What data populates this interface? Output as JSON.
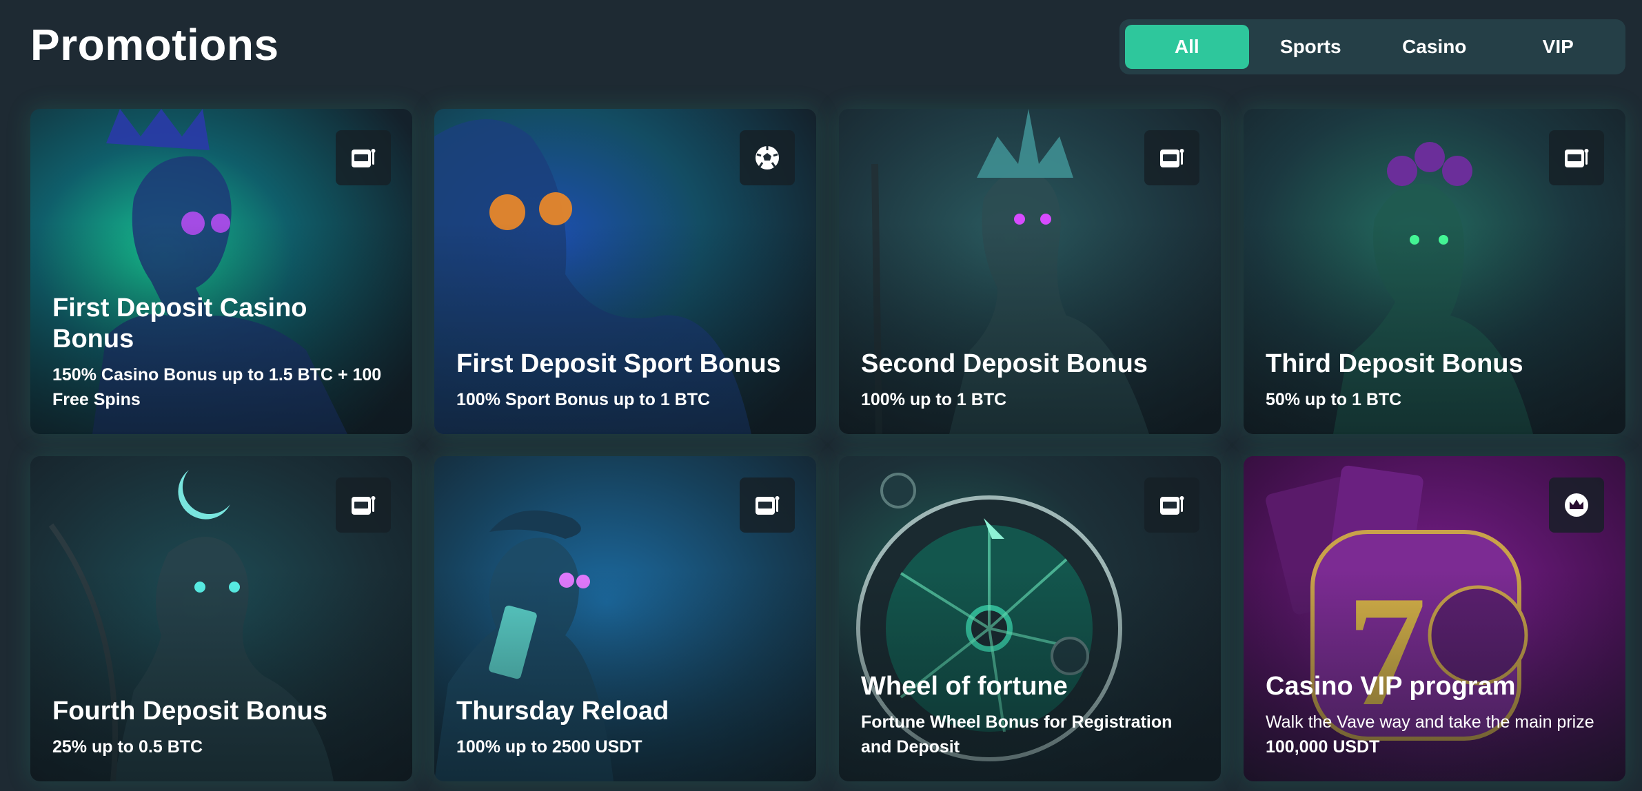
{
  "header": {
    "title": "Promotions"
  },
  "tabs": [
    {
      "label": "All",
      "active": true
    },
    {
      "label": "Sports",
      "active": false
    },
    {
      "label": "Casino",
      "active": false
    },
    {
      "label": "VIP",
      "active": false
    }
  ],
  "cards": [
    {
      "title": "First Deposit Casino Bonus",
      "subtitle": "150% Casino Bonus up to 1.5 BTC + 100 Free Spins",
      "icon": "slot-machine-icon"
    },
    {
      "title": "First Deposit Sport Bonus",
      "subtitle": "100% Sport Bonus up to 1 BTC",
      "icon": "soccer-ball-icon"
    },
    {
      "title": "Second Deposit Bonus",
      "subtitle": "100% up to 1 BTC",
      "icon": "slot-machine-icon"
    },
    {
      "title": "Third Deposit Bonus",
      "subtitle": "50% up to 1 BTC",
      "icon": "slot-machine-icon"
    },
    {
      "title": "Fourth Deposit Bonus",
      "subtitle": "25% up to 0.5 BTC",
      "icon": "slot-machine-icon"
    },
    {
      "title": "Thursday Reload",
      "subtitle": "100% up to 2500 USDT",
      "icon": "slot-machine-icon"
    },
    {
      "title": "Wheel of fortune",
      "subtitle": "Fortune Wheel Bonus for Registration and Deposit",
      "icon": "slot-machine-icon"
    },
    {
      "title": "Casino VIP program",
      "subtitle": "Walk the Vave way and take the main prize",
      "subtitle2": "100,000 USDT",
      "icon": "crown-icon"
    }
  ],
  "colors": {
    "background": "#1e2a33",
    "tabs_bg": "#253f47",
    "accent": "#2ec79c"
  }
}
